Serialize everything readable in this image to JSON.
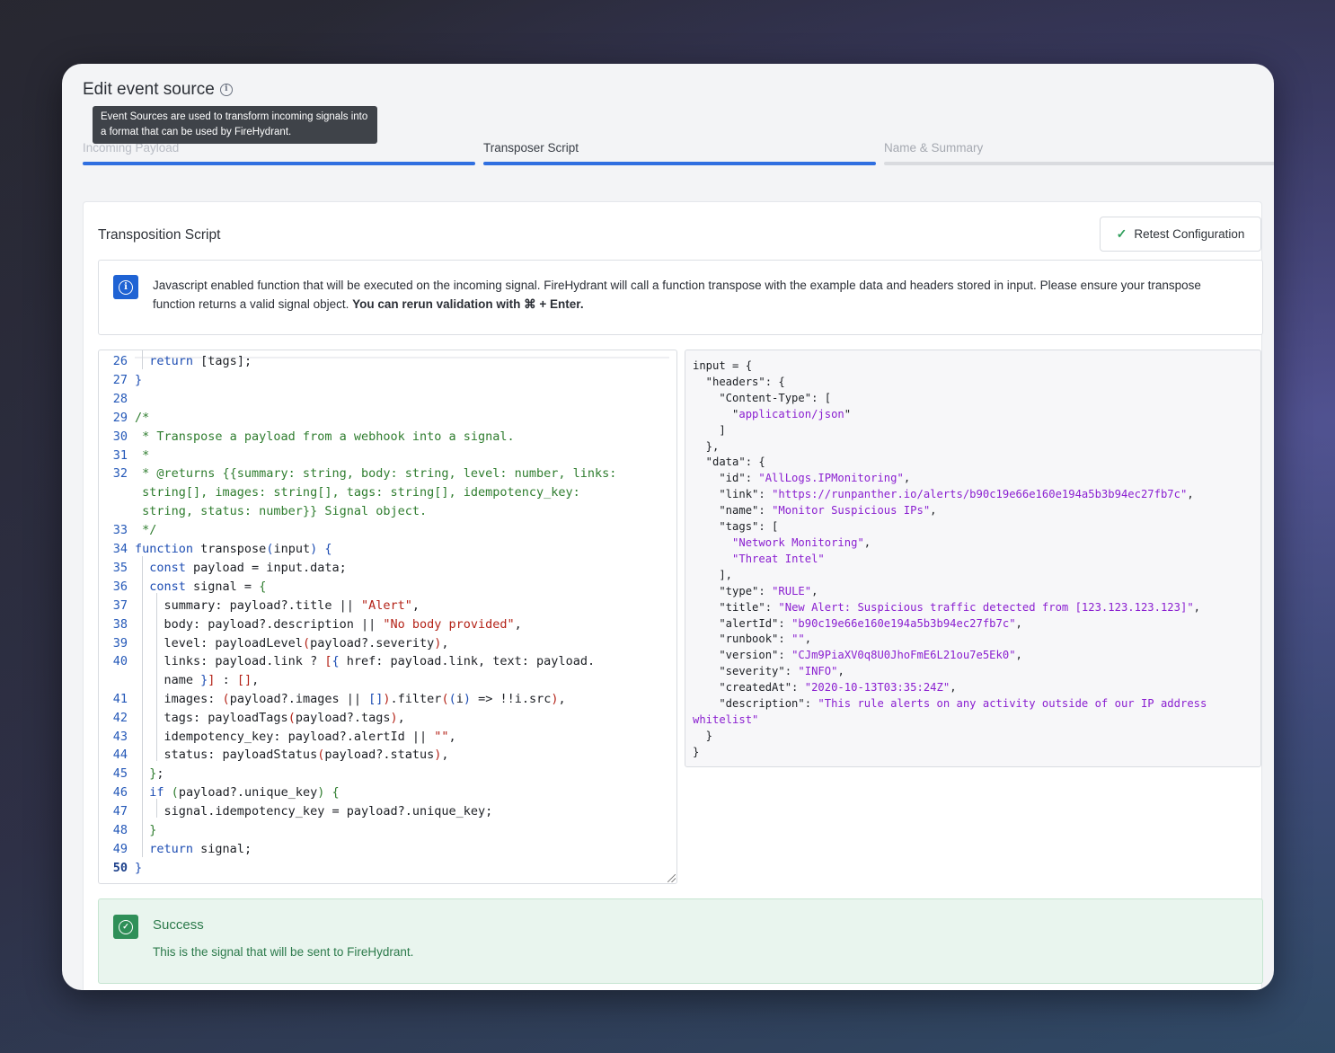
{
  "page": {
    "title": "Edit event source",
    "tooltip": "Event Sources are used to transform incoming signals into a format that can be used by FireHydrant."
  },
  "steps": [
    {
      "label": "Incoming Payload",
      "state": "done"
    },
    {
      "label": "Transposer Script",
      "state": "active"
    },
    {
      "label": "Name & Summary",
      "state": "todo"
    }
  ],
  "card": {
    "title": "Transposition Script",
    "retest_label": "Retest Configuration"
  },
  "notice": {
    "text": "Javascript enabled function that will be executed on the incoming signal. FireHydrant will call a function transpose with the example data and headers stored in input. Please ensure your transpose function returns a valid signal object.",
    "emphasis": "You can rerun validation with ⌘ + Enter."
  },
  "code": {
    "line_numbers": [
      "26",
      "27",
      "28",
      "29",
      "30",
      "31",
      "32",
      "33",
      "34",
      "35",
      "36",
      "37",
      "38",
      "39",
      "40",
      "41",
      "42",
      "43",
      "44",
      "45",
      "46",
      "47",
      "48",
      "49",
      "50"
    ],
    "current_line": "50"
  },
  "input_json": {
    "headers_content_type": "application/json",
    "id": "\"AllLogs.IPMonitoring\"",
    "link": "\"https://runpanther.io/alerts/b90c19e66e160e194a5b3b94ec27fb7c\"",
    "name": "\"Monitor Suspicious IPs\"",
    "tags": [
      "\"Network Monitoring\"",
      "\"Threat Intel\""
    ],
    "type": "\"RULE\"",
    "title": "\"New Alert: Suspicious traffic detected from [123.123.123.123]\"",
    "alertId": "\"b90c19e66e160e194a5b3b94ec27fb7c\"",
    "runbook": "\"\"",
    "version": "\"CJm9PiaXV0q8U0JhoFmE6L21ou7e5Ek0\"",
    "severity": "\"INFO\"",
    "createdAt": "\"2020-10-13T03:35:24Z\"",
    "description": "\"This rule alerts on any activity outside of our IP address whitelist\""
  },
  "success": {
    "title": "Success",
    "text": "This is the signal that will be sent to FireHydrant."
  },
  "colors": {
    "accent": "#2f6fe0",
    "success": "#2f8f58"
  }
}
